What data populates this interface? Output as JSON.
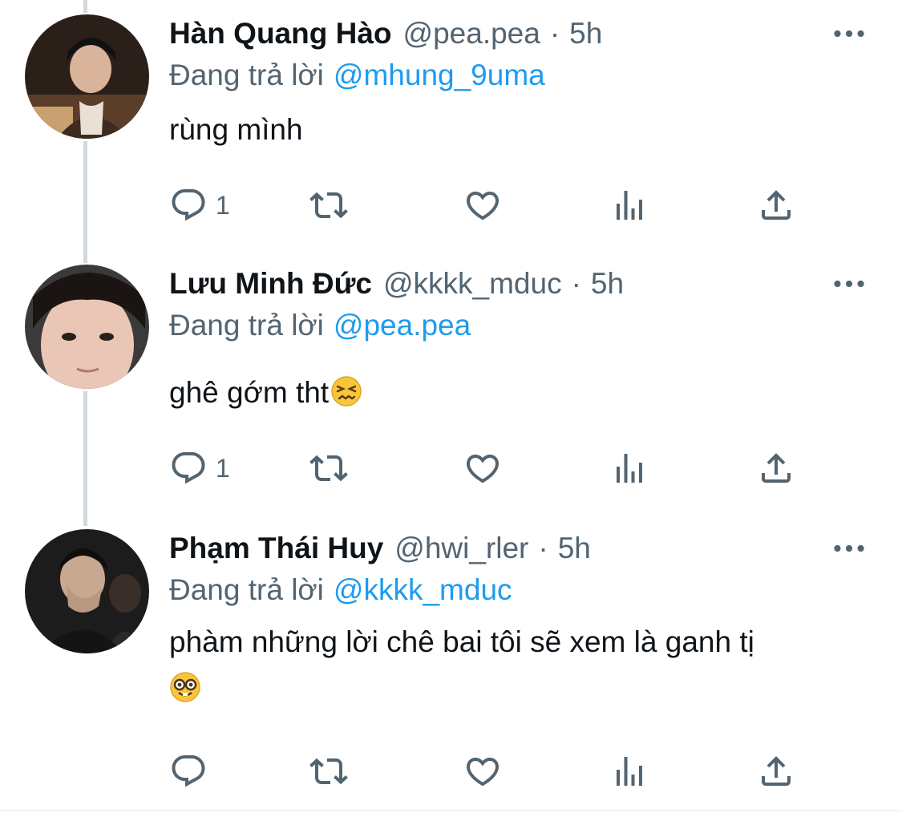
{
  "colors": {
    "accent": "#1d9bf0",
    "secondary_text": "#536471",
    "primary_text": "#0f1419",
    "thread_line": "#cfd9de"
  },
  "tweets": [
    {
      "display_name": "Hàn Quang Hào",
      "handle": "@pea.pea",
      "separator": "·",
      "time": "5h",
      "reply_prefix": "Đang trả lời",
      "reply_to": "@mhung_9uma",
      "text": "rùng mình",
      "emoji": "",
      "reply_count": "1",
      "icons": [
        "reply-icon",
        "retweet-icon",
        "like-icon",
        "analytics-icon",
        "share-icon",
        "more-icon"
      ]
    },
    {
      "display_name": "Lưu Minh Đức",
      "handle": "@kkkk_mduc",
      "separator": "·",
      "time": "5h",
      "reply_prefix": "Đang trả lời",
      "reply_to": "@pea.pea",
      "text": "ghê gớm tht",
      "emoji": "confounded-face-emoji",
      "reply_count": "1",
      "icons": [
        "reply-icon",
        "retweet-icon",
        "like-icon",
        "analytics-icon",
        "share-icon",
        "more-icon"
      ]
    },
    {
      "display_name": "Phạm Thái Huy",
      "handle": "@hwi_rler",
      "separator": "·",
      "time": "5h",
      "reply_prefix": "Đang trả lời",
      "reply_to": "@kkkk_mduc",
      "text": "phàm những lời chê bai tôi sẽ xem là ganh tị",
      "emoji": "nerd-face-emoji",
      "reply_count": "",
      "icons": [
        "reply-icon",
        "retweet-icon",
        "like-icon",
        "analytics-icon",
        "share-icon",
        "more-icon"
      ]
    }
  ]
}
